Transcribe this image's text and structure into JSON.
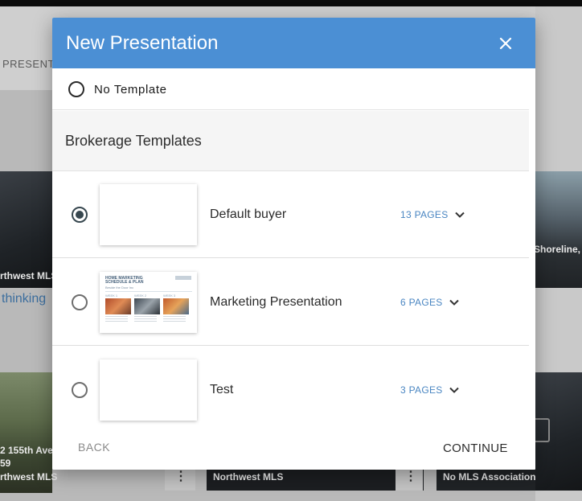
{
  "background": {
    "header_tab_fragment": "PRESENTA",
    "cards": [
      {
        "mls_label": "rthwest MLS",
        "link_fragment": "thinking"
      },
      {
        "location_fragment": "Shoreline,"
      },
      {
        "address_fragment_1": "2 155th Ave",
        "address_fragment_2": "59",
        "mls_label": "rthwest MLS"
      },
      {
        "mls_label": "Northwest MLS"
      },
      {
        "mls_label": "No MLS Association"
      }
    ],
    "menu_glyph": "⋮"
  },
  "modal": {
    "title": "New Presentation",
    "close_icon": "close-icon",
    "no_template_label": "No Template",
    "section_title": "Brokerage Templates",
    "templates": [
      {
        "name": "Default buyer",
        "pages": "13 PAGES",
        "selected": true
      },
      {
        "name": "Marketing Presentation",
        "pages": "6 PAGES",
        "selected": false,
        "thumb": {
          "title": "HOME MARKETING SCHEDULE & PLAN",
          "subtitle": "Beside the Door Inc",
          "weeks": [
            "WEEK 1",
            "WEEK 2",
            "WEEK 3"
          ]
        }
      },
      {
        "name": "Test",
        "pages": "3 PAGES",
        "selected": false
      }
    ],
    "back_label": "BACK",
    "continue_label": "CONTINUE"
  },
  "colors": {
    "header_blue": "#4b8fd4",
    "pages_link_blue": "#4a86c2",
    "radio_selected": "#37474f"
  }
}
